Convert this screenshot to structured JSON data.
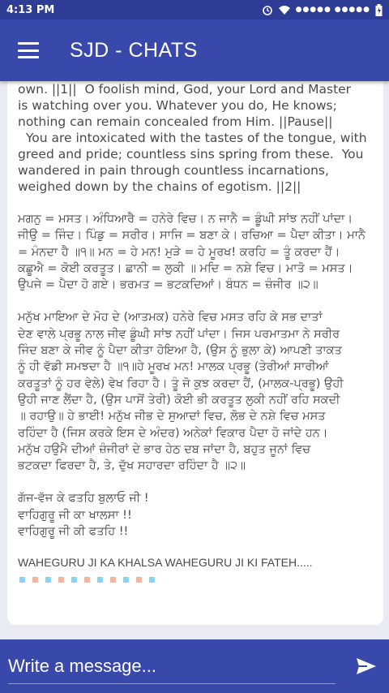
{
  "status_bar": {
    "time": "4:13 PM",
    "icons": [
      "alarm-icon",
      "wifi-icon",
      "signal-icon",
      "battery-icon"
    ],
    "signal_dots": "●●●●● ●●●●●"
  },
  "app_bar": {
    "title": "SJD - CHATS",
    "background": "#3949ab"
  },
  "message": {
    "english_lines": [
      "own. ||1||  O foolish mind, God, your Lord and Master",
      "is watching over you. Whatever you do, He knows;",
      "nothing can remain concealed from Him. ||Pause||",
      "  You are intoxicated with the tastes of the tongue, with",
      "greed and pride; countless sins spring from these.  You",
      "wandered in pain through countless incarnations,",
      "weighed down by the chains of egotism. ||2||"
    ],
    "glossary_lines": [
      "ਮਗਨੁ = ਮਸਤ। ਅੰਧਿਆਰੈ = ਹਨੇਰੇ ਵਿਚ। ਨ ਜਾਨੈ = ਡੂੰਘੀ ਸਾਂਝ ਨਹੀਂ ਪਾਂਦਾ।",
      "ਜੀਉ = ਜਿੰਦ। ਪਿੰਡੁ = ਸਰੀਰ। ਸਾਜਿ = ਬਣਾ ਕੇ। ਰਚਿਆ = ਪੈਦਾ ਕੀਤਾ। ਮਾਨੈ",
      "= ਮੰਨਦਾ ਹੈ ॥੧॥ ਮਨ = ਹੇ ਮਨ! ਮੁੜੇ = ਹੇ ਮੂਰਖ! ਕਰਹਿ = ਤੂੰ ਕਰਦਾ ਹੈਂ।",
      "ਕਛੂਐ = ਕੋਈ ਕਰਤੂਤ। ਛਾਨੀ = ਲੁਕੀ ॥ ਮਦਿ = ਨਸ਼ੇ ਵਿਚ। ਮਾਤੋ = ਮਸਤ।",
      "ਉਪਜੇ = ਪੈਦਾ ਹੋ ਗਏ। ਭਰਮਤ = ਭਟਕਦਿਆਂ। ਬੰਧਨ = ਜ਼ੰਜੀਰ ॥੨॥"
    ],
    "meaning_lines": [
      "ਮਨੁੱਖ ਮਾਇਆ ਦੇ ਮੋਹ ਦੇ (ਆਤਮਕ) ਹਨੇਰੇ ਵਿਚ ਮਸਤ ਰਹਿ ਕੇ ਸਭ ਦਾਤਾਂ",
      "ਦੇਣ ਵਾਲੇ ਪ੍ਰਭੂ ਨਾਲ ਜੀਵ ਡੂੰਘੀ ਸਾਂਝ ਨਹੀਂ ਪਾਂਦਾ। ਜਿਸ ਪਰਮਾਤਮਾ ਨੇ ਸਰੀਰ",
      "ਜਿੰਦ ਬਣਾ ਕੇ ਜੀਵ ਨੂੰ ਪੈਦਾ ਕੀਤਾ ਹੋਇਆ ਹੈ, (ਉਸ ਨੂੰ ਭੁਲਾ ਕੇ) ਆਪਣੀ ਤਾਕਤ",
      "ਨੂੰ ਹੀ ਵੱਡੀ ਸਮਝਦਾ ਹੈ ॥੧॥ਹੇ ਮੂਰਖ ਮਨ! ਮਾਲਕ ਪ੍ਰਭੂ (ਤੇਰੀਆਂ ਸਾਰੀਆਂ",
      "ਕਰਤੂਤਾਂ ਨੂੰ ਹਰ ਵੇਲੇ) ਵੇਖ ਰਿਹਾ ਹੈ। ਤੂੰ ਜੋ ਕੁਝ ਕਰਦਾ ਹੈਂ, (ਮਾਲਕ-ਪ੍ਰਭੂ) ਉਹੀ",
      "ਉਹੀ ਜਾਣ ਲੈਂਦਾ ਹੈ, (ਉਸ ਪਾਸੋਂ ਤੇਰੀ) ਕੋਈ ਭੀ ਕਰਤੂਤ ਲੁਕੀ ਨਹੀਂ ਰਹਿ ਸਕਦੀ",
      "॥ ਰਹਾਉ॥ ਹੇ ਭਾਈ! ਮਨੁੱਖ ਜੀਭ ਦੇ ਸੁਆਦਾਂ ਵਿਚ, ਲੋਭ ਦੇ ਨਸ਼ੇ ਵਿਚ ਮਸਤ",
      "ਰਹਿੰਦਾ ਹੈ (ਜਿਸ ਕਰਕੇ ਇਸ ਦੇ ਅੰਦਰ) ਅਨੇਕਾਂ ਵਿਕਾਰ ਪੈਦਾ ਹੋ ਜਾਂਦੇ ਹਨ।",
      "ਮਨੁੱਖ ਹਉਮੈ ਦੀਆਂ ਜ਼ੰਜੀਰਾਂ ਦੇ ਭਾਰ ਹੇਠ ਦਬ ਜਾਂਦਾ ਹੈ, ਬਹੁਤ ਜੂਨਾਂ ਵਿਚ",
      "ਭਟਕਦਾ ਫਿਰਦਾ ਹੈ, ਤੇ, ਦੁੱਖ ਸਹਾਰਦਾ ਰਹਿੰਦਾ ਹੈ ॥੨॥"
    ],
    "closing_lines": [
      "ਗੱਜ-ਵੱਜ ਕੇ ਫਤਹਿ ਬੁਲਾਓ ਜੀ !",
      "ਵਾਹਿਗੁਰੂ ਜੀ ਕਾ ਖਾਲਸਾ !!",
      "ਵਾਹਿਗੁਰੂ ਜੀ ਕੀ ਫਤਹਿ !!"
    ],
    "footer": "WAHEGURU JI KA KHALSA WAHEGURU JI KI FATEH.....",
    "dot_colors": [
      "#8fd0ee",
      "#f5b7a2",
      "#8fd0ee",
      "#f5b7a2",
      "#8fd0ee",
      "#f5b7a2",
      "#8fd0ee",
      "#f5b7a2",
      "#8fd0ee",
      "#f5b7a2",
      "#8fd0ee"
    ]
  },
  "composer": {
    "placeholder": "Write a message...",
    "send_icon": "send-icon"
  }
}
